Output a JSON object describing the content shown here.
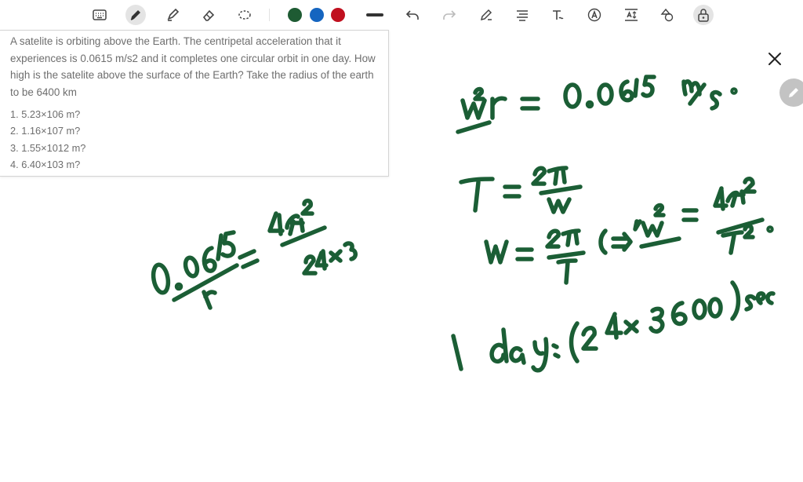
{
  "toolbar": {
    "tools": [
      "keyboard-icon",
      "pen-icon",
      "highlighter-icon",
      "eraser-icon",
      "lasso-icon"
    ],
    "active_tool": "pen-icon",
    "colors": [
      "#1e5b33",
      "#1565c0",
      "#c0101f"
    ],
    "actions": [
      "line-thickness-icon",
      "undo-icon",
      "redo-icon",
      "pen-settings-icon",
      "text-align-icon",
      "handwriting-text-icon",
      "text-style-icon",
      "text-size-icon",
      "shapes-icon",
      "lock-icon"
    ]
  },
  "question": {
    "text": "A satelite is orbiting above the Earth. The centripetal acceleration that it experiences is 0.0615 m/s2 and it completes one circular orbit in one day. How high is the satelite above the surface of the Earth? Take the radius of the earth to be 6400 km",
    "options": [
      "1. 5.23×106 m?",
      "2. 1.16×107 m?",
      "3. 1.55×1012 m?",
      "4. 6.40×103 m?"
    ]
  },
  "ink_color": "#1b5e35"
}
